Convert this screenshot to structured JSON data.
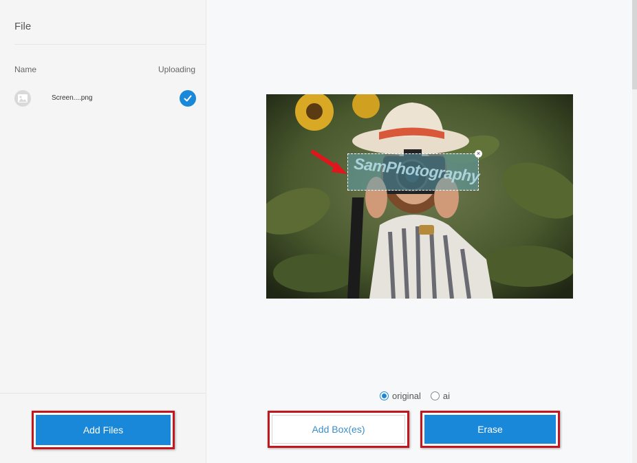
{
  "sidebar": {
    "title": "File",
    "columns": {
      "name": "Name",
      "status": "Uploading"
    },
    "files": [
      {
        "name": "Screen....png",
        "status_icon": "check-circle-icon",
        "thumb_icon": "image-icon"
      }
    ],
    "add_files_label": "Add Files"
  },
  "preview": {
    "watermark_text": "SamPhotography",
    "selection_close": "×"
  },
  "mode": {
    "options": [
      {
        "label": "original",
        "checked": true
      },
      {
        "label": "ai",
        "checked": false
      }
    ]
  },
  "actions": {
    "add_box_label": "Add Box(es)",
    "erase_label": "Erase"
  },
  "colors": {
    "accent": "#1a88d8",
    "highlight": "#c0161c",
    "annotation_arrow": "#e0161c"
  }
}
